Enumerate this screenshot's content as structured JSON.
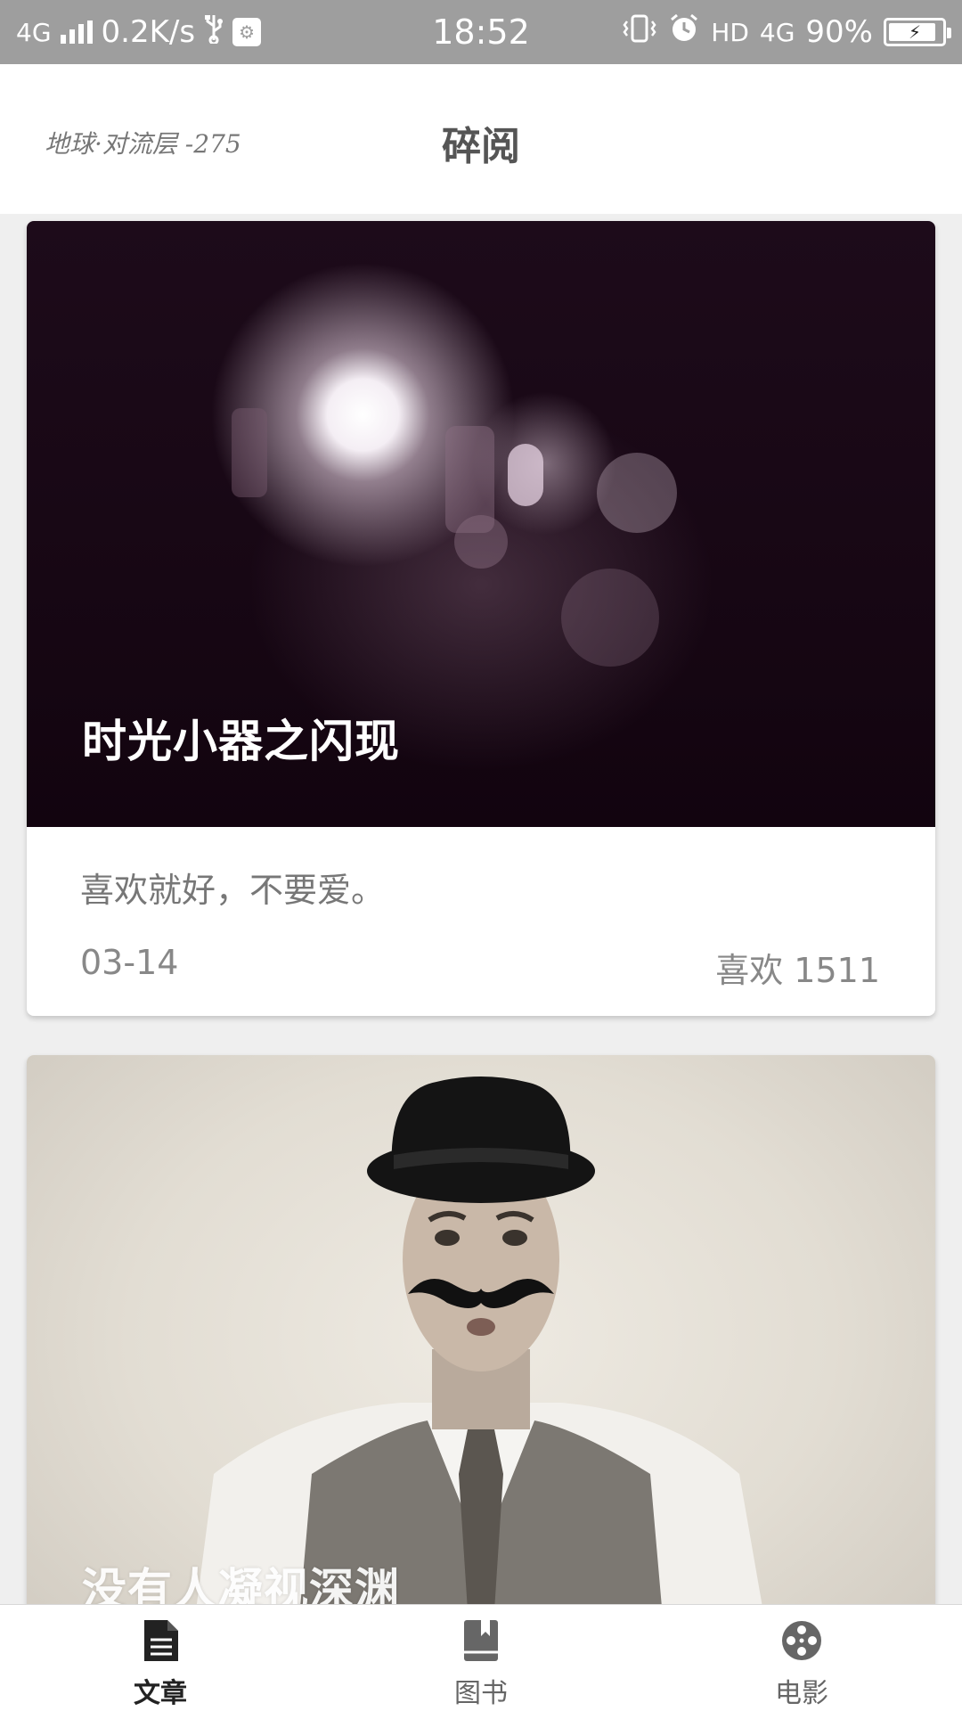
{
  "status_bar": {
    "network": "4G",
    "speed": "0.2K/s",
    "time": "18:52",
    "hd": "HD",
    "network_right": "4G",
    "battery": "90%",
    "battery_level": 0.9
  },
  "header": {
    "location": "地球·对流层 -275",
    "title": "碎阅"
  },
  "cards": [
    {
      "title": "时光小器之闪现",
      "excerpt": "喜欢就好，不要爱。",
      "date": "03-14",
      "likes": "喜欢 1511"
    },
    {
      "title": "没有人凝视深渊"
    }
  ],
  "tabs": [
    {
      "label": "文章",
      "icon": "article-icon",
      "active": true
    },
    {
      "label": "图书",
      "icon": "book-icon",
      "active": false
    },
    {
      "label": "电影",
      "icon": "film-reel-icon",
      "active": false
    }
  ],
  "colors": {
    "status_bar_bg": "#9e9e9e",
    "page_bg": "#efefef",
    "active_tab": "#222222",
    "inactive_tab": "#666666"
  }
}
